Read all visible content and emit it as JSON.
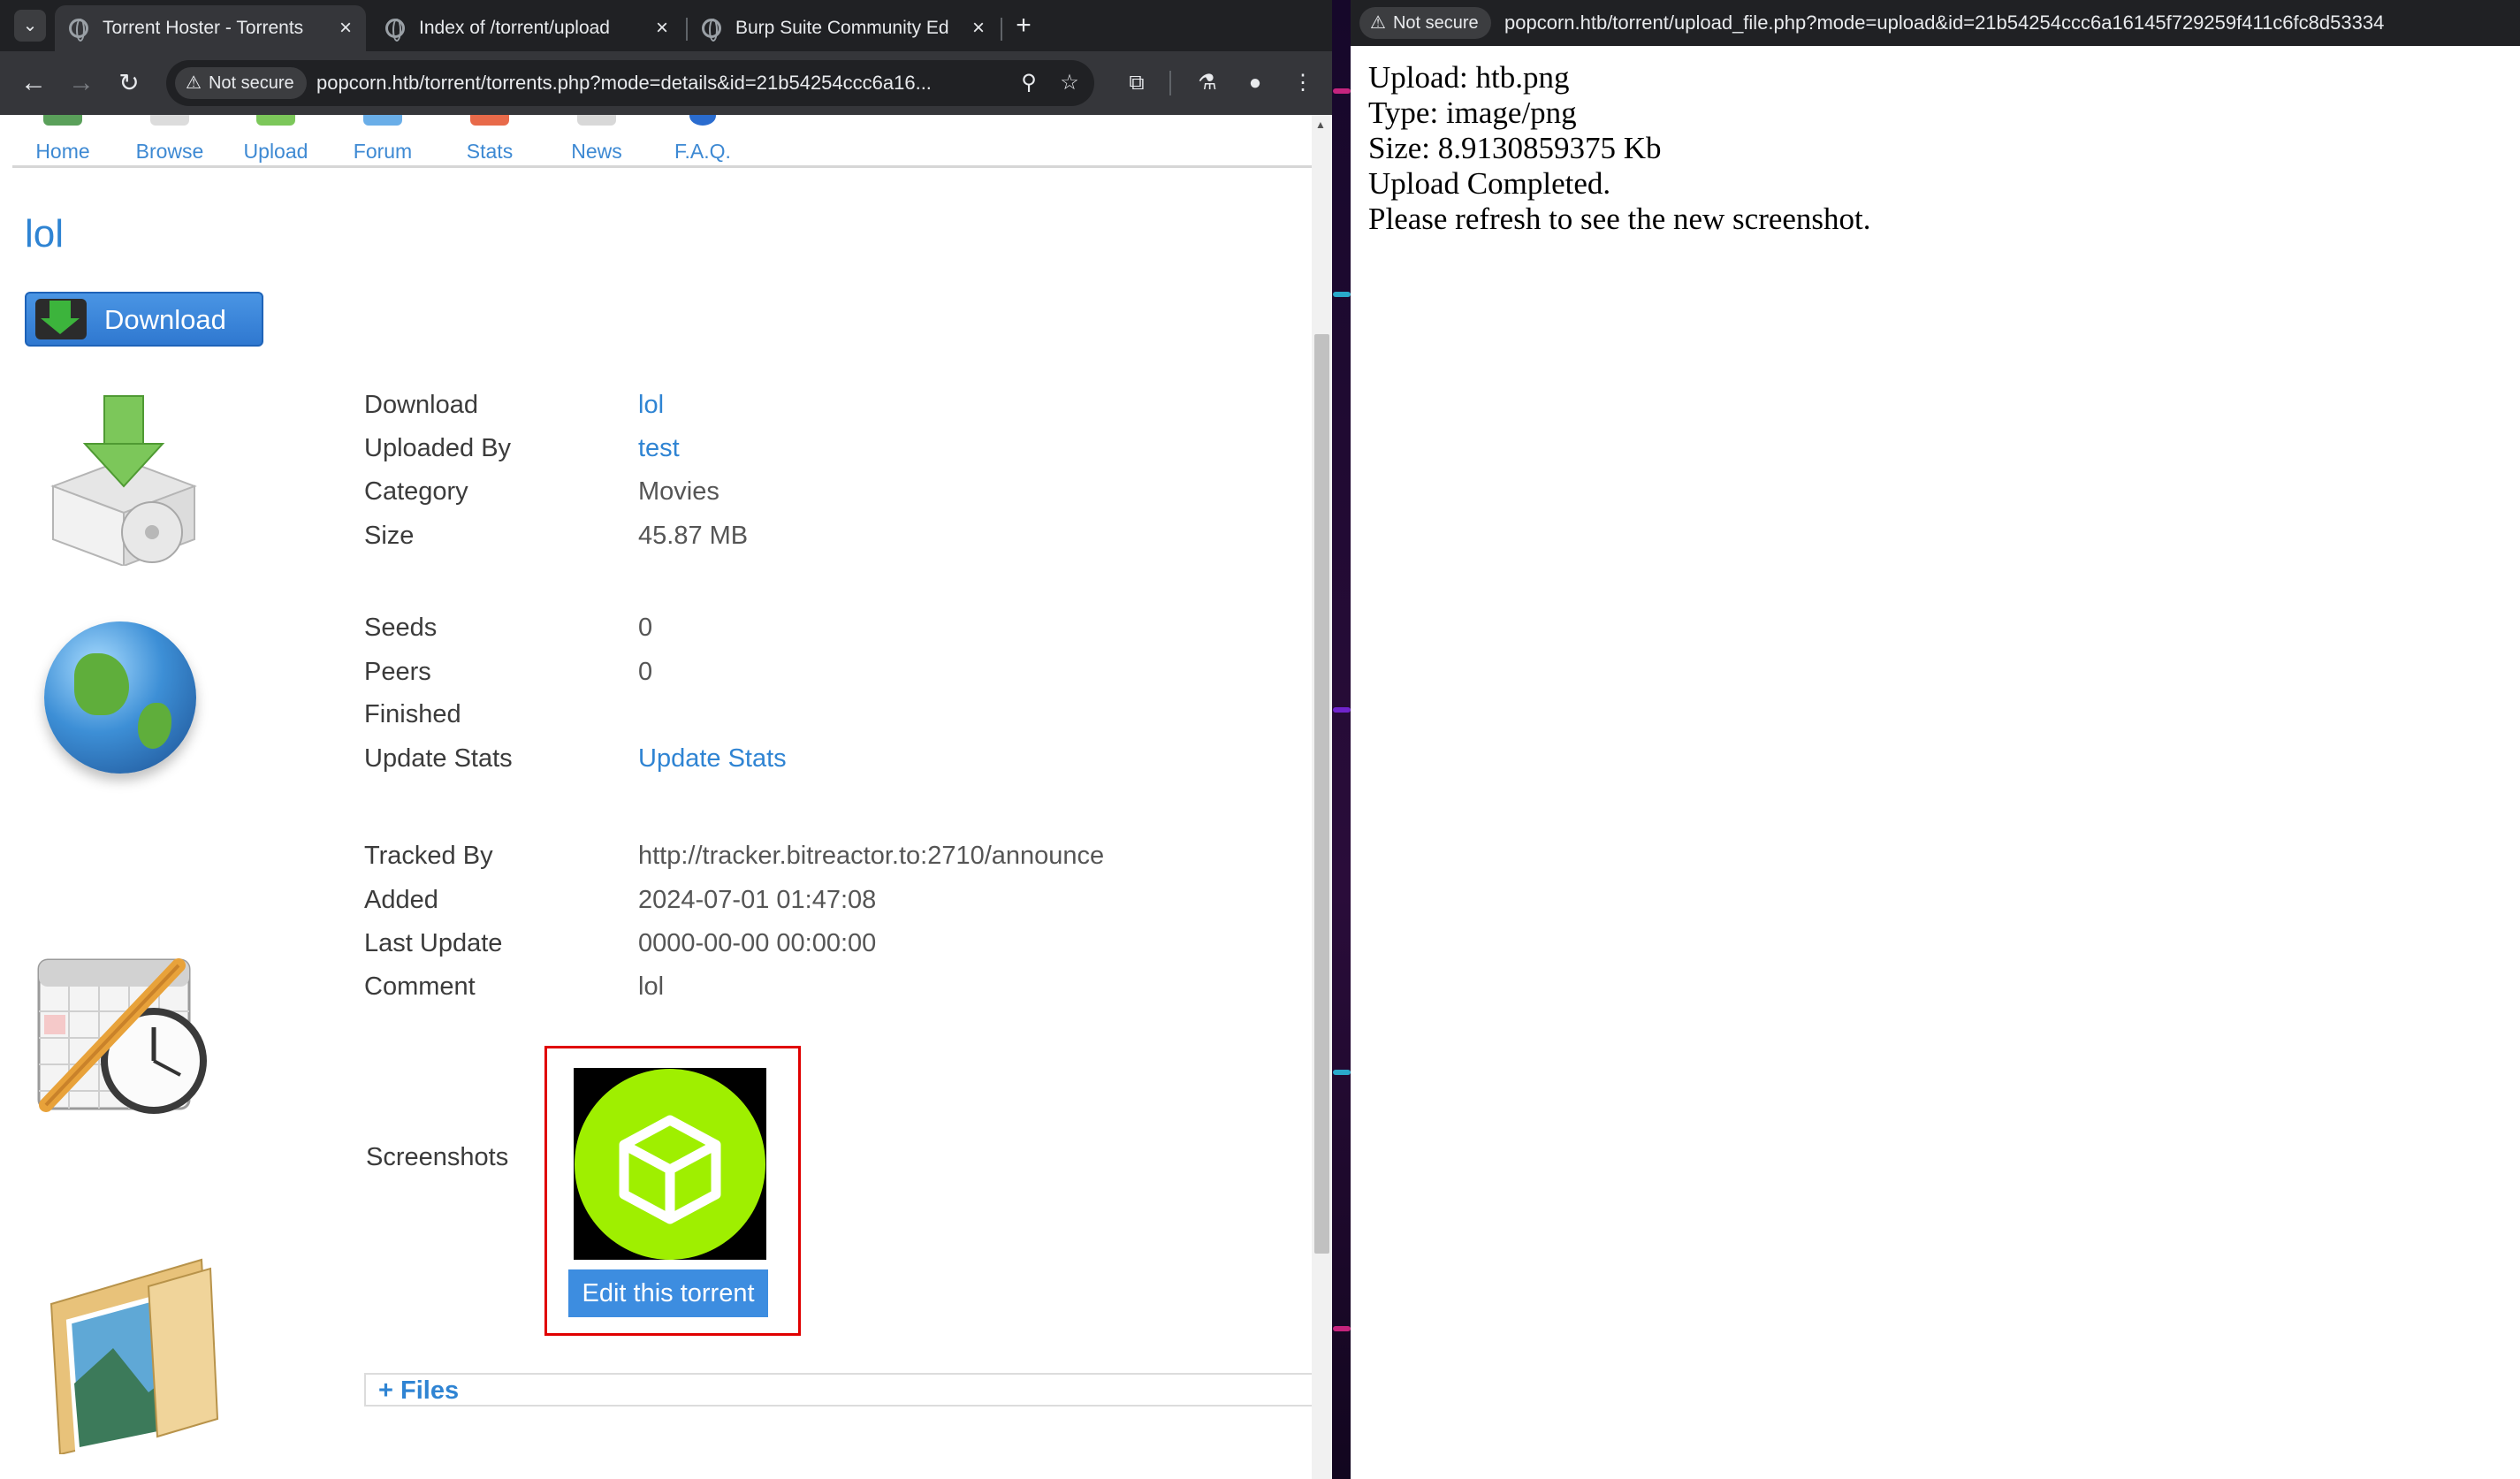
{
  "left_browser": {
    "tabs": [
      {
        "title": "Torrent Hoster - Torrents",
        "active": true
      },
      {
        "title": "Index of /torrent/upload",
        "active": false
      },
      {
        "title": "Burp Suite Community Ed",
        "active": false
      }
    ],
    "tab_close_glyph": "×",
    "new_tab_glyph": "+",
    "tab_list_glyph": "⌄",
    "security_label": "Not secure",
    "url": "popcorn.htb/torrent/torrents.php?mode=details&id=21b54254ccc6a16...",
    "icons": {
      "back": "back-arrow-icon",
      "forward": "forward-arrow-icon",
      "reload": "reload-icon",
      "zoom": "zoom-icon",
      "bookmark": "star-icon",
      "extensions": "puzzle-icon",
      "labs": "flask-icon",
      "profile": "profile-icon",
      "menu": "kebab-menu-icon"
    }
  },
  "site": {
    "nav": [
      "Home",
      "Browse",
      "Upload",
      "Forum",
      "Stats",
      "News",
      "F.A.Q."
    ],
    "torrent_title": "lol",
    "download_button": "Download",
    "details": [
      {
        "label": "Download",
        "value": "lol",
        "link": true
      },
      {
        "label": "Uploaded By",
        "value": "test",
        "link": true
      },
      {
        "label": "Category",
        "value": "Movies",
        "link": false
      },
      {
        "label": "Size",
        "value": "45.87 MB",
        "link": false
      }
    ],
    "stats": [
      {
        "label": "Seeds",
        "value": "0",
        "link": false
      },
      {
        "label": "Peers",
        "value": "0",
        "link": false
      },
      {
        "label": "Finished",
        "value": "",
        "link": false
      },
      {
        "label": "Update Stats",
        "value": "Update Stats",
        "link": true
      }
    ],
    "tracking": [
      {
        "label": "Tracked By",
        "value": "http://tracker.bitreactor.to:2710/announce"
      },
      {
        "label": "Added",
        "value": "2024-07-01 01:47:08"
      },
      {
        "label": "Last Update",
        "value": "0000-00-00 00:00:00"
      },
      {
        "label": "Comment",
        "value": "lol"
      }
    ],
    "screenshots_label": "Screenshots",
    "edit_button": "Edit this torrent",
    "files_toggle": "+ Files"
  },
  "right_browser": {
    "security_label": "Not secure",
    "url": "popcorn.htb/torrent/upload_file.php?mode=upload&id=21b54254ccc6a16145f729259f411c6fc8d53334",
    "lines": [
      "Upload: htb.png",
      "Type: image/png",
      "Size: 8.9130859375 Kb",
      "Upload Completed.",
      "Please refresh to see the new screenshot."
    ]
  },
  "colors": {
    "link_blue": "#2f84d3",
    "highlight_red": "#e00000",
    "htb_green": "#9fef00",
    "chrome_dark": "#202124"
  }
}
